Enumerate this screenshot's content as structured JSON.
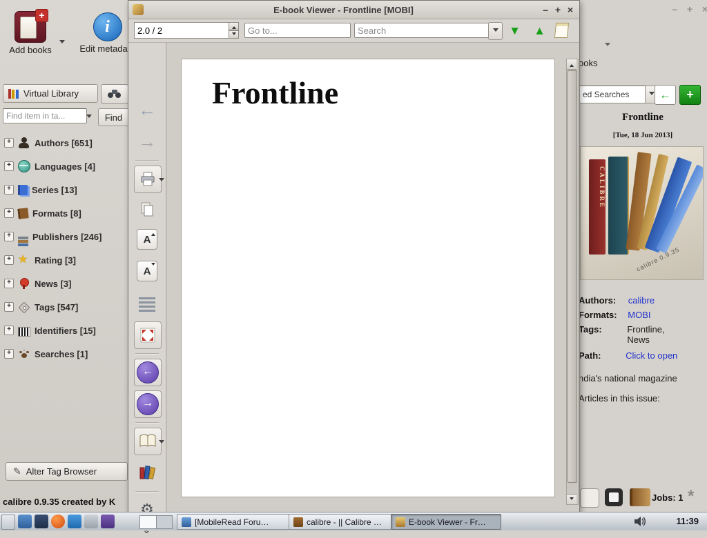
{
  "window_controls": {
    "minimize": "–",
    "maximize": "+",
    "close": "×"
  },
  "icons": {
    "plus": "+",
    "info": "i",
    "letter_a": "A",
    "up_triangle": "▲",
    "down_triangle": "▼",
    "back_arrow": "←",
    "forward_arrow": "→",
    "gear": "⚙",
    "pencil": "✎",
    "star": "★",
    "chevron_more": "»",
    "spinner": "*",
    "expander": "+"
  },
  "viewer": {
    "title": "E-book Viewer - Frontline [MOBI]",
    "page_value": "2.0 / 2",
    "goto_placeholder": "Go to...",
    "search_placeholder": "Search",
    "heading": "Frontline"
  },
  "calibre": {
    "add_books_label": "Add books",
    "edit_metadata_label": "Edit metadata",
    "partial_toolbar_label": "ooks",
    "virtual_library_label": "Virtual Library",
    "find_placeholder": "Find item in ta...",
    "find_button_label": "Find",
    "tag_browser": [
      {
        "label": "Authors [651]"
      },
      {
        "label": "Languages [4]"
      },
      {
        "label": "Series [13]"
      },
      {
        "label": "Formats [8]"
      },
      {
        "label": "Publishers [246]"
      },
      {
        "label": "Rating [3]"
      },
      {
        "label": "News [3]"
      },
      {
        "label": "Tags [547]"
      },
      {
        "label": "Identifiers [15]"
      },
      {
        "label": "Searches [1]"
      }
    ],
    "alter_tag_browser_label": "Alter Tag Browser",
    "status_text": "calibre 0.9.35 created by K"
  },
  "details": {
    "saved_searches_value": "ed Searches",
    "title": "Frontline",
    "date": "[Tue, 18 Jun 2013]",
    "cover_spine_text": "CALIBRE",
    "cover_caption": "calibre 0.9.35",
    "authors_label": "Authors:",
    "authors_value": "calibre",
    "formats_label": "Formats:",
    "formats_value": "MOBI",
    "tags_label": "Tags:",
    "tags_value": "Frontline, News",
    "path_label": "Path:",
    "path_value": "Click to open",
    "line1": "ndia's national magazine",
    "line2": "Articles in this issue:",
    "jobs_label": "Jobs: 1"
  },
  "taskbar": {
    "windows": [
      {
        "title": "[MobileRead Foru…"
      },
      {
        "title": "calibre - || Calibre …"
      },
      {
        "title": "E-book Viewer - Fr…"
      }
    ],
    "clock": "11:39"
  }
}
